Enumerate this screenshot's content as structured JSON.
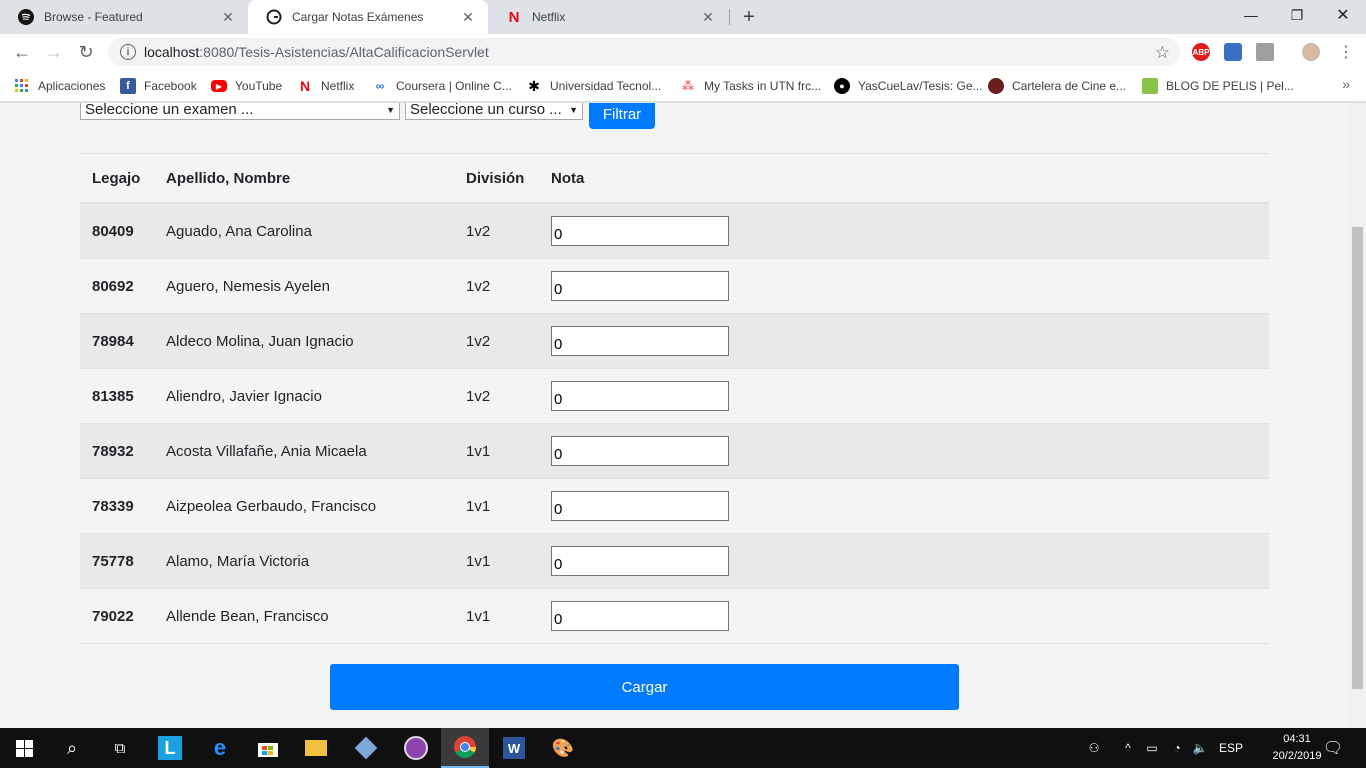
{
  "browser": {
    "tabs": [
      {
        "title": "Browse - Featured",
        "icon": "spotify-icon",
        "active": false
      },
      {
        "title": "Cargar Notas Exámenes",
        "icon": "generic-site-icon",
        "active": true
      },
      {
        "title": "Netflix",
        "icon": "netflix-icon",
        "active": false
      }
    ],
    "url_host": "localhost",
    "url_rest": ":8080/Tesis-Asistencias/AltaCalificacionServlet",
    "bookmarks": [
      {
        "label": "Aplicaciones",
        "icon": "apps-grid-icon"
      },
      {
        "label": "Facebook",
        "icon": "facebook-icon"
      },
      {
        "label": "YouTube",
        "icon": "youtube-icon"
      },
      {
        "label": "Netflix",
        "icon": "netflix-icon"
      },
      {
        "label": "Coursera | Online C...",
        "icon": "coursera-icon"
      },
      {
        "label": "Universidad Tecnol...",
        "icon": "utn-icon"
      },
      {
        "label": "My Tasks in UTN frc...",
        "icon": "asana-icon"
      },
      {
        "label": "YasCueLav/Tesis: Ge...",
        "icon": "github-icon"
      },
      {
        "label": "Cartelera de Cine e...",
        "icon": "cinema-icon"
      },
      {
        "label": "BLOG DE PELIS | Pel...",
        "icon": "blog-icon"
      }
    ]
  },
  "filters": {
    "exam_select": "Seleccione un examen ...",
    "course_select": "Seleccione un curso ...",
    "filter_button": "Filtrar"
  },
  "table": {
    "headers": [
      "Legajo",
      "Apellido, Nombre",
      "División",
      "Nota"
    ],
    "rows": [
      {
        "legajo": "80409",
        "nombre": "Aguado, Ana Carolina",
        "division": "1v2",
        "nota": "0"
      },
      {
        "legajo": "80692",
        "nombre": "Aguero, Nemesis Ayelen",
        "division": "1v2",
        "nota": "0"
      },
      {
        "legajo": "78984",
        "nombre": "Aldeco Molina, Juan Ignacio",
        "division": "1v2",
        "nota": "0"
      },
      {
        "legajo": "81385",
        "nombre": "Aliendro, Javier Ignacio",
        "division": "1v2",
        "nota": "0"
      },
      {
        "legajo": "78932",
        "nombre": "Acosta Villafañe, Ania Micaela",
        "division": "1v1",
        "nota": "0"
      },
      {
        "legajo": "78339",
        "nombre": "Aizpeolea Gerbaudo, Francisco",
        "division": "1v1",
        "nota": "0"
      },
      {
        "legajo": "75778",
        "nombre": "Alamo, María Victoria",
        "division": "1v1",
        "nota": "0"
      },
      {
        "legajo": "79022",
        "nombre": "Allende Bean, Francisco",
        "division": "1v1",
        "nota": "0"
      }
    ]
  },
  "submit_button": "Cargar",
  "taskbar": {
    "language": "ESP",
    "time": "04:31",
    "date": "20/2/2019"
  },
  "colors": {
    "primary": "#007bff",
    "row_stripe": "#e9e9e9",
    "page_bg": "#f4f4f4"
  }
}
